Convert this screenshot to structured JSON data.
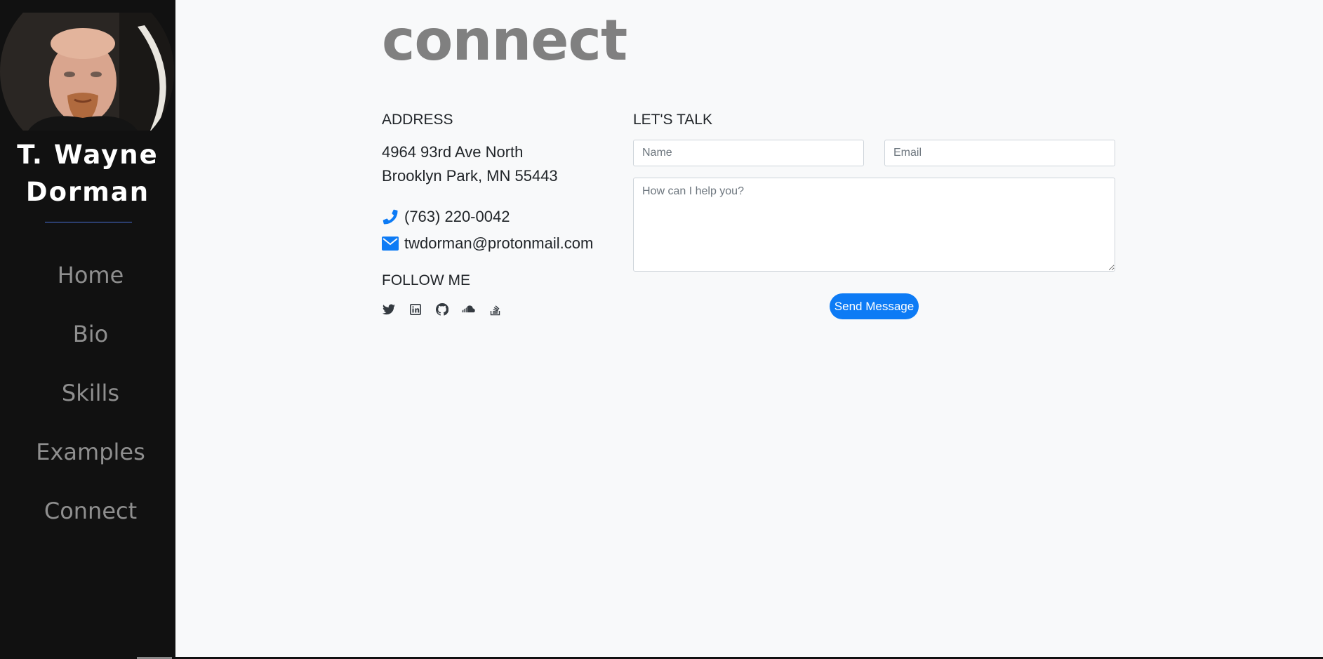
{
  "sidebar": {
    "name_line1": "T. Wayne",
    "name_line2": "Dorman",
    "nav": [
      {
        "label": "Home"
      },
      {
        "label": "Bio"
      },
      {
        "label": "Skills"
      },
      {
        "label": "Examples"
      },
      {
        "label": "Connect"
      }
    ]
  },
  "page": {
    "heading": "connect"
  },
  "address": {
    "title": "ADDRESS",
    "line1": "4964 93rd Ave North",
    "line2": "Brooklyn Park, MN 55443",
    "phone": "(763) 220-0042",
    "email": "twdorman@protonmail.com",
    "phone_icon": "phone-icon",
    "email_icon": "envelope-icon"
  },
  "follow": {
    "title": "FOLLOW ME",
    "icons": [
      "twitter-icon",
      "linkedin-icon",
      "github-icon",
      "soundcloud-icon",
      "stack-overflow-icon"
    ]
  },
  "form": {
    "title": "LET'S TALK",
    "name_placeholder": "Name",
    "email_placeholder": "Email",
    "message_placeholder": "How can I help you?",
    "submit_label": "Send Message"
  },
  "colors": {
    "accent": "#0d7bf5",
    "sidebar_bg": "#111111",
    "page_bg": "#f8f9fa"
  }
}
